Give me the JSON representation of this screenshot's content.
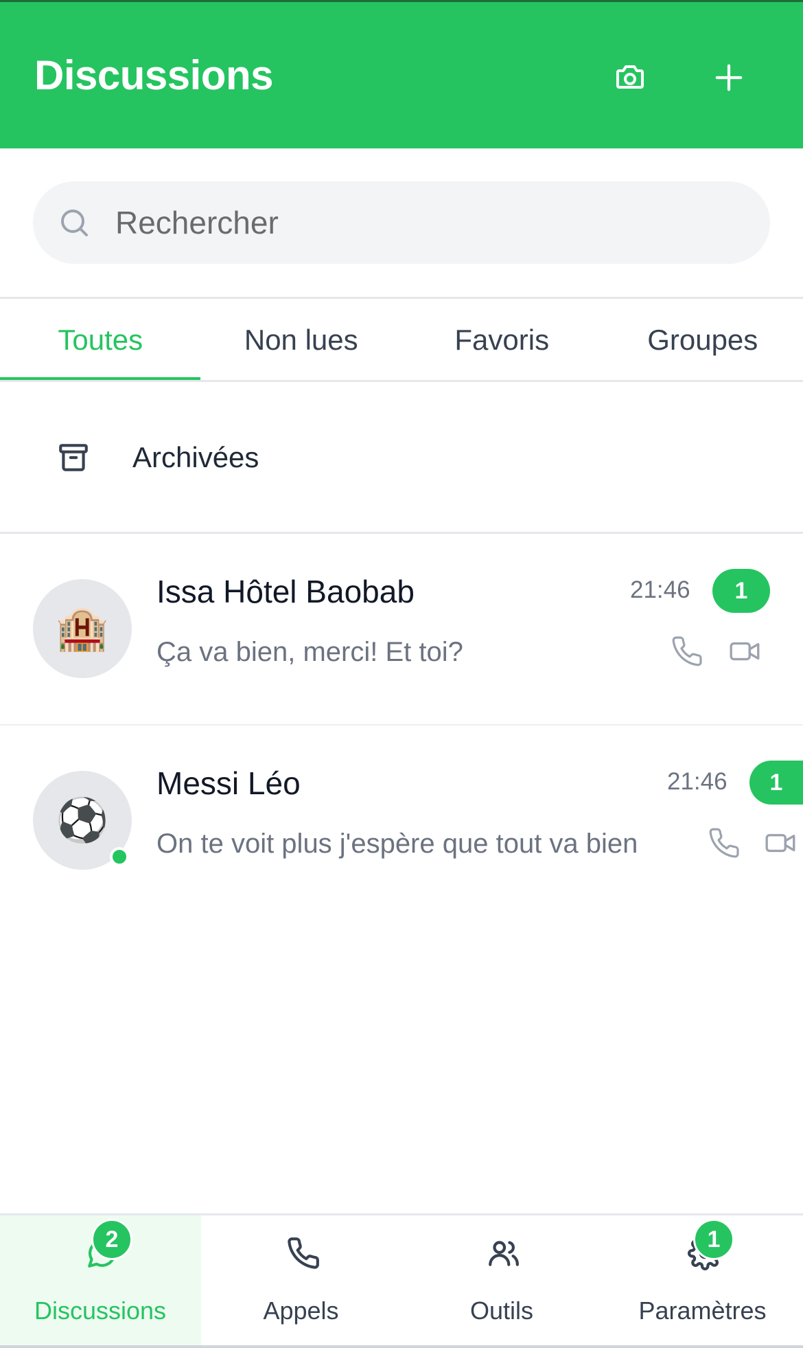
{
  "header": {
    "title": "Discussions",
    "camera_icon": "camera-icon",
    "plus_icon": "plus-icon"
  },
  "search": {
    "placeholder": "Rechercher",
    "value": ""
  },
  "tabs": [
    {
      "label": "Toutes",
      "active": true
    },
    {
      "label": "Non lues",
      "active": false
    },
    {
      "label": "Favoris",
      "active": false
    },
    {
      "label": "Groupes",
      "active": false
    }
  ],
  "archived": {
    "label": "Archivées",
    "icon": "archive-icon"
  },
  "chats": [
    {
      "name": "Issa Hôtel Baobab",
      "preview": "Ça va bien, merci! Et toi?",
      "time": "21:46",
      "unread": "1",
      "avatar": "🏨",
      "online": false
    },
    {
      "name": "Messi Léo",
      "preview": "On te voit plus j'espère que tout va bien",
      "time": "21:46",
      "unread": "1",
      "avatar": "⚽",
      "online": true
    }
  ],
  "nav": [
    {
      "label": "Discussions",
      "icon": "chat-icon",
      "badge": "2",
      "active": true
    },
    {
      "label": "Appels",
      "icon": "phone-icon",
      "badge": "",
      "active": false
    },
    {
      "label": "Outils",
      "icon": "users-icon",
      "badge": "",
      "active": false
    },
    {
      "label": "Paramètres",
      "icon": "gear-icon",
      "badge": "1",
      "active": false
    }
  ],
  "colors": {
    "accent": "#25c460",
    "header_bg": "#25c460",
    "muted_text": "#6b7280"
  }
}
